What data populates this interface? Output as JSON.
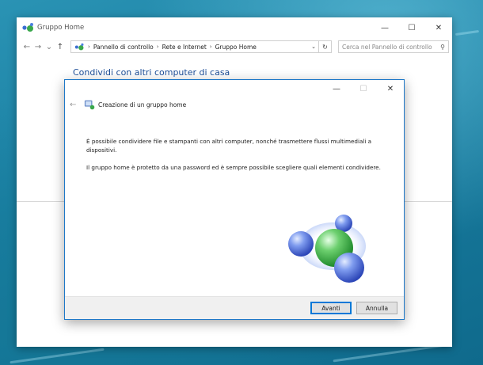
{
  "main_window": {
    "title": "Gruppo Home",
    "controls": {
      "minimize": "—",
      "maximize": "☐",
      "close": "✕"
    },
    "nav": {
      "back": "←",
      "forward": "→",
      "recent": "⌄",
      "up": "↑"
    },
    "breadcrumb": [
      "Pannello di controllo",
      "Rete e Internet",
      "Gruppo Home"
    ],
    "breadcrumb_separator": "›",
    "address_dropdown": "⌄",
    "refresh": "↻",
    "search_placeholder": "Cerca nel Pannello di controllo",
    "heading": "Condividi con altri computer di casa"
  },
  "dialog": {
    "title": "Creazione di un gruppo home",
    "back": "←",
    "controls": {
      "minimize": "—",
      "maximize": "☐",
      "close": "✕"
    },
    "paragraph1": "È possibile condividere file e stampanti con altri computer, nonché trasmettere flussi multimediali a dispositivi.",
    "paragraph2": "Il gruppo home è protetto da una password ed è sempre possibile scegliere quali elementi condividere.",
    "next_button": "Avanti",
    "cancel_button": "Annulla"
  },
  "icons": {
    "app_icon": "homegroup-icon",
    "dialog_icon": "homegroup-icon",
    "search_icon": "search-icon"
  },
  "colors": {
    "accent": "#0078d7",
    "heading": "#1e4f99",
    "dialog_border": "#1e78c8"
  }
}
